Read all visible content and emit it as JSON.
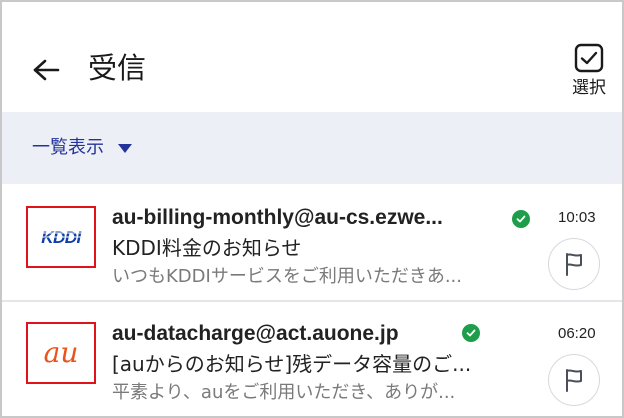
{
  "header": {
    "title": "受信",
    "back_icon": "arrow-left-icon",
    "select_label": "選択",
    "select_icon": "checkbox-checked-icon"
  },
  "filter": {
    "label": "一覧表示",
    "caret_icon": "triangle-down-icon",
    "accent_color": "#24339a"
  },
  "mails": [
    {
      "logo": "KDDI",
      "logo_icon": "kddi-logo-icon",
      "sender": "au-billing-monthly@au-cs.ezwe...",
      "verified": true,
      "subject": "KDDI料金のお知らせ",
      "preview": "いつもKDDIサービスをご利用いただきあ...",
      "time": "10:03",
      "flag_icon": "flag-icon"
    },
    {
      "logo": "au",
      "logo_icon": "au-logo-icon",
      "sender": "au-datacharge@act.auone.jp",
      "verified": true,
      "subject": "[auからのお知らせ]残データ容量のご...",
      "preview": "平素より、auをご利用いただき、ありが...",
      "time": "06:20",
      "flag_icon": "flag-icon"
    }
  ],
  "colors": {
    "verified": "#1e9d4a",
    "logo_border": "#e0121a",
    "kddi_blue": "#0f3fa6",
    "au_orange": "#e8541b"
  }
}
